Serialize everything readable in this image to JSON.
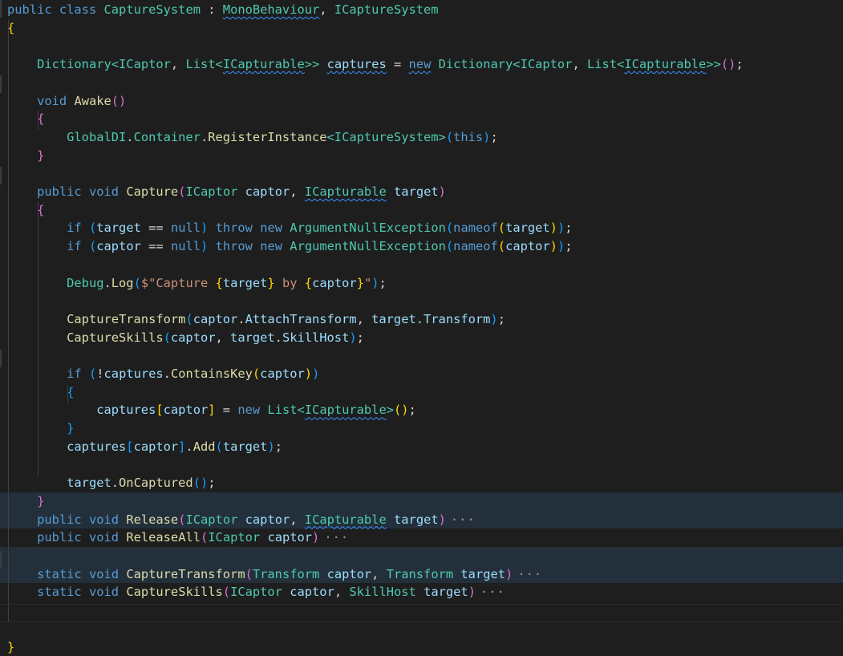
{
  "lines": [
    [
      {
        "t": "public",
        "c": "k"
      },
      {
        "t": " "
      },
      {
        "t": "class",
        "c": "k"
      },
      {
        "t": " "
      },
      {
        "t": "CaptureSystem",
        "c": "t"
      },
      {
        "t": " : "
      },
      {
        "t": "MonoBehaviour",
        "c": "t",
        "sq": true
      },
      {
        "t": ", "
      },
      {
        "t": "ICaptureSystem",
        "c": "t"
      }
    ],
    [
      {
        "t": "{",
        "c": "b1"
      }
    ],
    [],
    [
      {
        "t": "    "
      },
      {
        "t": "Dictionary",
        "c": "t"
      },
      {
        "t": "<",
        "c": "t"
      },
      {
        "t": "ICaptor",
        "c": "t"
      },
      {
        "t": ", "
      },
      {
        "t": "List",
        "c": "t"
      },
      {
        "t": "<",
        "c": "t"
      },
      {
        "t": "ICapturable",
        "c": "t",
        "sq": true
      },
      {
        "t": ">>",
        "c": "t"
      },
      {
        "t": " "
      },
      {
        "t": "captures",
        "c": "v",
        "sq": true
      },
      {
        "t": " = "
      },
      {
        "t": "new",
        "c": "k",
        "sq": true
      },
      {
        "t": " "
      },
      {
        "t": "Dictionary",
        "c": "t"
      },
      {
        "t": "<",
        "c": "t"
      },
      {
        "t": "ICaptor",
        "c": "t"
      },
      {
        "t": ", "
      },
      {
        "t": "List",
        "c": "t"
      },
      {
        "t": "<",
        "c": "t"
      },
      {
        "t": "ICapturable",
        "c": "t",
        "sq": true
      },
      {
        "t": ">>",
        "c": "t"
      },
      {
        "t": "()",
        "c": "b2"
      },
      {
        "t": ";"
      }
    ],
    [],
    [
      {
        "t": "    "
      },
      {
        "t": "void",
        "c": "k"
      },
      {
        "t": " "
      },
      {
        "t": "Awake",
        "c": "f"
      },
      {
        "t": "()",
        "c": "b2"
      }
    ],
    [
      {
        "t": "    "
      },
      {
        "t": "{",
        "c": "b2"
      }
    ],
    [
      {
        "t": "        "
      },
      {
        "t": "GlobalDI",
        "c": "t"
      },
      {
        "t": "."
      },
      {
        "t": "Container",
        "c": "t"
      },
      {
        "t": "."
      },
      {
        "t": "RegisterInstance",
        "c": "f"
      },
      {
        "t": "<",
        "c": "t"
      },
      {
        "t": "ICaptureSystem",
        "c": "t"
      },
      {
        "t": ">",
        "c": "t"
      },
      {
        "t": "(",
        "c": "b3"
      },
      {
        "t": "this",
        "c": "k"
      },
      {
        "t": ")",
        "c": "b3"
      },
      {
        "t": ";"
      }
    ],
    [
      {
        "t": "    "
      },
      {
        "t": "}",
        "c": "b2"
      }
    ],
    [],
    [
      {
        "t": "    "
      },
      {
        "t": "public",
        "c": "k"
      },
      {
        "t": " "
      },
      {
        "t": "void",
        "c": "k"
      },
      {
        "t": " "
      },
      {
        "t": "Capture",
        "c": "f"
      },
      {
        "t": "(",
        "c": "b2"
      },
      {
        "t": "ICaptor",
        "c": "t"
      },
      {
        "t": " "
      },
      {
        "t": "captor",
        "c": "v"
      },
      {
        "t": ", "
      },
      {
        "t": "ICapturable",
        "c": "t",
        "sq": true
      },
      {
        "t": " "
      },
      {
        "t": "target",
        "c": "v"
      },
      {
        "t": ")",
        "c": "b2"
      }
    ],
    [
      {
        "t": "    "
      },
      {
        "t": "{",
        "c": "b2"
      }
    ],
    [
      {
        "t": "        "
      },
      {
        "t": "if",
        "c": "k"
      },
      {
        "t": " "
      },
      {
        "t": "(",
        "c": "b3"
      },
      {
        "t": "target",
        "c": "v"
      },
      {
        "t": " == "
      },
      {
        "t": "null",
        "c": "k"
      },
      {
        "t": ")",
        "c": "b3"
      },
      {
        "t": " "
      },
      {
        "t": "throw",
        "c": "k"
      },
      {
        "t": " "
      },
      {
        "t": "new",
        "c": "k"
      },
      {
        "t": " "
      },
      {
        "t": "ArgumentNullException",
        "c": "t"
      },
      {
        "t": "(",
        "c": "b3"
      },
      {
        "t": "nameof",
        "c": "k"
      },
      {
        "t": "(",
        "c": "b1"
      },
      {
        "t": "target",
        "c": "v"
      },
      {
        "t": ")",
        "c": "b1"
      },
      {
        "t": ")",
        "c": "b3"
      },
      {
        "t": ";"
      }
    ],
    [
      {
        "t": "        "
      },
      {
        "t": "if",
        "c": "k"
      },
      {
        "t": " "
      },
      {
        "t": "(",
        "c": "b3"
      },
      {
        "t": "captor",
        "c": "v"
      },
      {
        "t": " == "
      },
      {
        "t": "null",
        "c": "k"
      },
      {
        "t": ")",
        "c": "b3"
      },
      {
        "t": " "
      },
      {
        "t": "throw",
        "c": "k"
      },
      {
        "t": " "
      },
      {
        "t": "new",
        "c": "k"
      },
      {
        "t": " "
      },
      {
        "t": "ArgumentNullException",
        "c": "t"
      },
      {
        "t": "(",
        "c": "b3"
      },
      {
        "t": "nameof",
        "c": "k"
      },
      {
        "t": "(",
        "c": "b1"
      },
      {
        "t": "captor",
        "c": "v"
      },
      {
        "t": ")",
        "c": "b1"
      },
      {
        "t": ")",
        "c": "b3"
      },
      {
        "t": ";"
      }
    ],
    [],
    [
      {
        "t": "        "
      },
      {
        "t": "Debug",
        "c": "t"
      },
      {
        "t": "."
      },
      {
        "t": "Log",
        "c": "f"
      },
      {
        "t": "(",
        "c": "b3"
      },
      {
        "t": "$\"Capture ",
        "c": "s"
      },
      {
        "t": "{",
        "c": "b1"
      },
      {
        "t": "target",
        "c": "v"
      },
      {
        "t": "}",
        "c": "b1"
      },
      {
        "t": " by ",
        "c": "s"
      },
      {
        "t": "{",
        "c": "b1"
      },
      {
        "t": "captor",
        "c": "v"
      },
      {
        "t": "}",
        "c": "b1"
      },
      {
        "t": "\"",
        "c": "s"
      },
      {
        "t": ")",
        "c": "b3"
      },
      {
        "t": ";"
      }
    ],
    [],
    [
      {
        "t": "        "
      },
      {
        "t": "CaptureTransform",
        "c": "f"
      },
      {
        "t": "(",
        "c": "b3"
      },
      {
        "t": "captor",
        "c": "v"
      },
      {
        "t": "."
      },
      {
        "t": "AttachTransform",
        "c": "v"
      },
      {
        "t": ", "
      },
      {
        "t": "target",
        "c": "v"
      },
      {
        "t": "."
      },
      {
        "t": "Transform",
        "c": "v"
      },
      {
        "t": ")",
        "c": "b3"
      },
      {
        "t": ";"
      }
    ],
    [
      {
        "t": "        "
      },
      {
        "t": "CaptureSkills",
        "c": "f"
      },
      {
        "t": "(",
        "c": "b3"
      },
      {
        "t": "captor",
        "c": "v"
      },
      {
        "t": ", "
      },
      {
        "t": "target",
        "c": "v"
      },
      {
        "t": "."
      },
      {
        "t": "SkillHost",
        "c": "v"
      },
      {
        "t": ")",
        "c": "b3"
      },
      {
        "t": ";"
      }
    ],
    [],
    [
      {
        "t": "        "
      },
      {
        "t": "if",
        "c": "k"
      },
      {
        "t": " "
      },
      {
        "t": "(",
        "c": "b3"
      },
      {
        "t": "!"
      },
      {
        "t": "captures",
        "c": "v"
      },
      {
        "t": "."
      },
      {
        "t": "ContainsKey",
        "c": "f"
      },
      {
        "t": "(",
        "c": "b1"
      },
      {
        "t": "captor",
        "c": "v"
      },
      {
        "t": ")",
        "c": "b1"
      },
      {
        "t": ")",
        "c": "b3"
      }
    ],
    [
      {
        "t": "        "
      },
      {
        "t": "{",
        "c": "b3"
      }
    ],
    [
      {
        "t": "            "
      },
      {
        "t": "captures",
        "c": "v"
      },
      {
        "t": "[",
        "c": "b1"
      },
      {
        "t": "captor",
        "c": "v"
      },
      {
        "t": "]",
        "c": "b1"
      },
      {
        "t": " = "
      },
      {
        "t": "new",
        "c": "k"
      },
      {
        "t": " "
      },
      {
        "t": "List",
        "c": "t"
      },
      {
        "t": "<",
        "c": "t"
      },
      {
        "t": "ICapturable",
        "c": "t",
        "sq": true
      },
      {
        "t": ">",
        "c": "t"
      },
      {
        "t": "()",
        "c": "b1"
      },
      {
        "t": ";"
      }
    ],
    [
      {
        "t": "        "
      },
      {
        "t": "}",
        "c": "b3"
      }
    ],
    [
      {
        "t": "        "
      },
      {
        "t": "captures",
        "c": "v"
      },
      {
        "t": "[",
        "c": "b3"
      },
      {
        "t": "captor",
        "c": "v"
      },
      {
        "t": "]",
        "c": "b3"
      },
      {
        "t": "."
      },
      {
        "t": "Add",
        "c": "f"
      },
      {
        "t": "(",
        "c": "b3"
      },
      {
        "t": "target",
        "c": "v"
      },
      {
        "t": ")",
        "c": "b3"
      },
      {
        "t": ";"
      }
    ],
    [],
    [
      {
        "t": "        "
      },
      {
        "t": "target",
        "c": "v"
      },
      {
        "t": "."
      },
      {
        "t": "OnCaptured",
        "c": "f"
      },
      {
        "t": "()",
        "c": "b3"
      },
      {
        "t": ";"
      }
    ],
    [
      {
        "t": "    "
      },
      {
        "t": "}",
        "c": "b2"
      }
    ],
    [
      {
        "t": "    "
      },
      {
        "t": "public",
        "c": "k"
      },
      {
        "t": " "
      },
      {
        "t": "void",
        "c": "k"
      },
      {
        "t": " "
      },
      {
        "t": "Release",
        "c": "f"
      },
      {
        "t": "(",
        "c": "b2"
      },
      {
        "t": "ICaptor",
        "c": "t"
      },
      {
        "t": " "
      },
      {
        "t": "captor",
        "c": "v"
      },
      {
        "t": ", "
      },
      {
        "t": "ICapturable",
        "c": "t",
        "sq": true
      },
      {
        "t": " "
      },
      {
        "t": "target",
        "c": "v"
      },
      {
        "t": ")",
        "c": "b2"
      },
      {
        "t": "···",
        "c": "dots"
      }
    ],
    [
      {
        "t": "    "
      },
      {
        "t": "public",
        "c": "k"
      },
      {
        "t": " "
      },
      {
        "t": "void",
        "c": "k"
      },
      {
        "t": " "
      },
      {
        "t": "ReleaseAll",
        "c": "f"
      },
      {
        "t": "(",
        "c": "b2"
      },
      {
        "t": "ICaptor",
        "c": "t"
      },
      {
        "t": " "
      },
      {
        "t": "captor",
        "c": "v"
      },
      {
        "t": ")",
        "c": "b2"
      },
      {
        "t": "···",
        "c": "dots"
      }
    ],
    [],
    [
      {
        "t": "    "
      },
      {
        "t": "static",
        "c": "k"
      },
      {
        "t": " "
      },
      {
        "t": "void",
        "c": "k"
      },
      {
        "t": " "
      },
      {
        "t": "CaptureTransform",
        "c": "f"
      },
      {
        "t": "(",
        "c": "b2"
      },
      {
        "t": "Transform",
        "c": "t"
      },
      {
        "t": " "
      },
      {
        "t": "captor",
        "c": "v"
      },
      {
        "t": ", "
      },
      {
        "t": "Transform",
        "c": "t"
      },
      {
        "t": " "
      },
      {
        "t": "target",
        "c": "v"
      },
      {
        "t": ")",
        "c": "b2"
      },
      {
        "t": "···",
        "c": "dots"
      }
    ],
    [
      {
        "t": "    "
      },
      {
        "t": "static",
        "c": "k"
      },
      {
        "t": " "
      },
      {
        "t": "void",
        "c": "k"
      },
      {
        "t": " "
      },
      {
        "t": "CaptureSkills",
        "c": "f"
      },
      {
        "t": "(",
        "c": "b2"
      },
      {
        "t": "ICaptor",
        "c": "t"
      },
      {
        "t": " "
      },
      {
        "t": "captor",
        "c": "v"
      },
      {
        "t": ", "
      },
      {
        "t": "SkillHost",
        "c": "t"
      },
      {
        "t": " "
      },
      {
        "t": "target",
        "c": "v"
      },
      {
        "t": ")",
        "c": "b2"
      },
      {
        "t": "···",
        "c": "dots"
      }
    ],
    [],
    [],
    [
      {
        "t": "}",
        "c": "b1"
      }
    ]
  ],
  "folded_lines": [
    27,
    28,
    30,
    31
  ],
  "colors": {
    "background": "#1e1e1e",
    "keyword": "#569cd6",
    "type": "#4ec9b0",
    "function": "#dcdcaa",
    "variable": "#9cdcfe",
    "string": "#ce9178",
    "bracket_gold": "#ffd700",
    "bracket_purple": "#da70d6",
    "bracket_blue": "#179fff",
    "squiggle": "#3794ff",
    "folded_highlight": "#23303b"
  }
}
